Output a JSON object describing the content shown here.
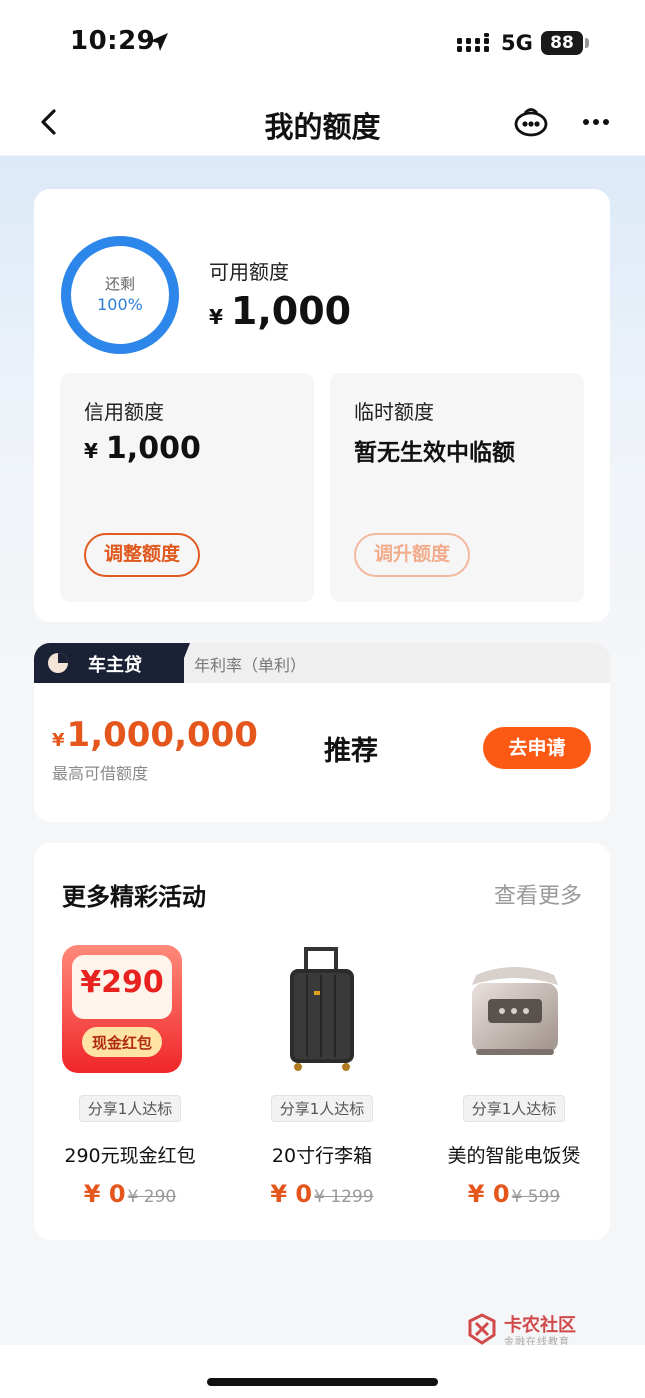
{
  "status_bar": {
    "time": "10:29",
    "network": "5G",
    "battery": "88"
  },
  "nav": {
    "title": "我的额度"
  },
  "quota": {
    "ring_caption": "还剩",
    "ring_percent": "100%",
    "ring_fraction": 1.0,
    "available_label": "可用额度",
    "currency": "¥",
    "available_amount": "1,000",
    "credit": {
      "label": "信用额度",
      "amount": "1,000",
      "button": "调整额度"
    },
    "temporary": {
      "label": "临时额度",
      "value": "暂无生效中临额",
      "button": "调升额度"
    }
  },
  "loan": {
    "name": "车主贷",
    "rate_label": "年利率（单利）",
    "currency": "¥",
    "amount": "1,000,000",
    "amount_sub": "最高可借额度",
    "recommend": "推荐",
    "apply_button": "去申请"
  },
  "activities": {
    "title": "更多精彩活动",
    "more": "查看更多",
    "items": [
      {
        "badge": "分享1人达标",
        "name": "290元现金红包",
        "price": "¥ 0",
        "old_price": "¥ 290",
        "image_amount": "¥290",
        "image_tag": "现金红包",
        "icon": "red-packet-icon"
      },
      {
        "badge": "分享1人达标",
        "name": "20寸行李箱",
        "price": "¥ 0",
        "old_price": "¥ 1299",
        "icon": "suitcase-icon"
      },
      {
        "badge": "分享1人达标",
        "name": "美的智能电饭煲",
        "price": "¥ 0",
        "old_price": "¥ 599",
        "icon": "rice-cooker-icon"
      }
    ]
  },
  "watermark": {
    "text": "卡农社区",
    "sub": "金融在线教育"
  },
  "colors": {
    "accent": "#fc5a14",
    "ring": "#2f7ed8",
    "dark_tag": "#1b2236"
  }
}
